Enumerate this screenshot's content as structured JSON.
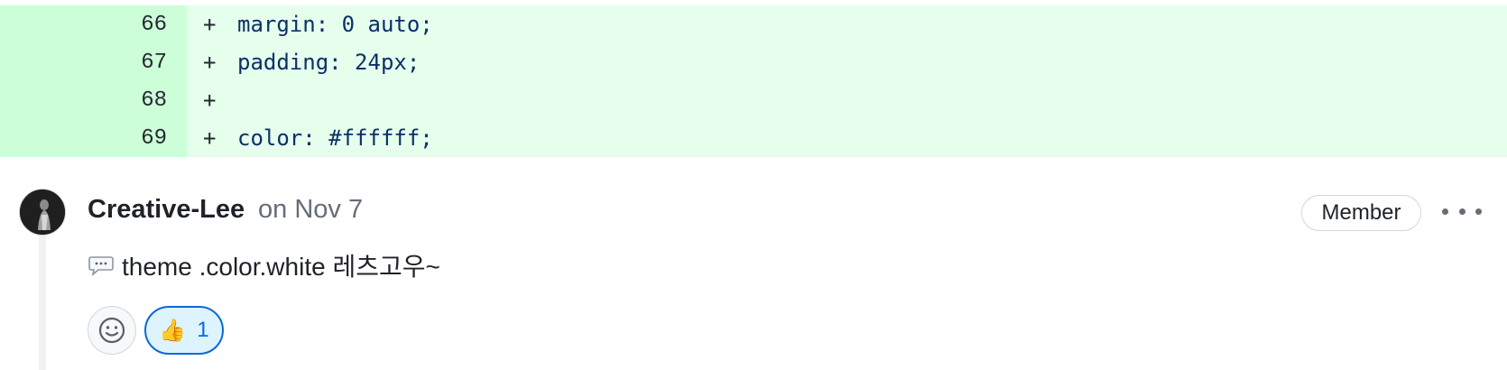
{
  "diff": {
    "lines": [
      {
        "number": "66",
        "marker": "+",
        "code": "margin: 0 auto;"
      },
      {
        "number": "67",
        "marker": "+",
        "code": "padding: 24px;"
      },
      {
        "number": "68",
        "marker": "+",
        "code": ""
      },
      {
        "number": "69",
        "marker": "+",
        "code": "color: #ffffff;"
      }
    ]
  },
  "comment": {
    "author": "Creative-Lee",
    "date": "on Nov 7",
    "badge": "Member",
    "body": "theme .color.white 레츠고우~",
    "icons": {
      "body": "speech-bubble-icon",
      "more": "kebab-menu-icon",
      "add_reaction": "smiley-icon",
      "reaction": "thumbs-up-icon"
    }
  },
  "reactions": [
    {
      "emoji": "👍",
      "count": "1"
    }
  ],
  "colors": {
    "added_line": "#e6ffec",
    "added_gutter": "#ccffd8",
    "reaction_active": "#0969da"
  }
}
